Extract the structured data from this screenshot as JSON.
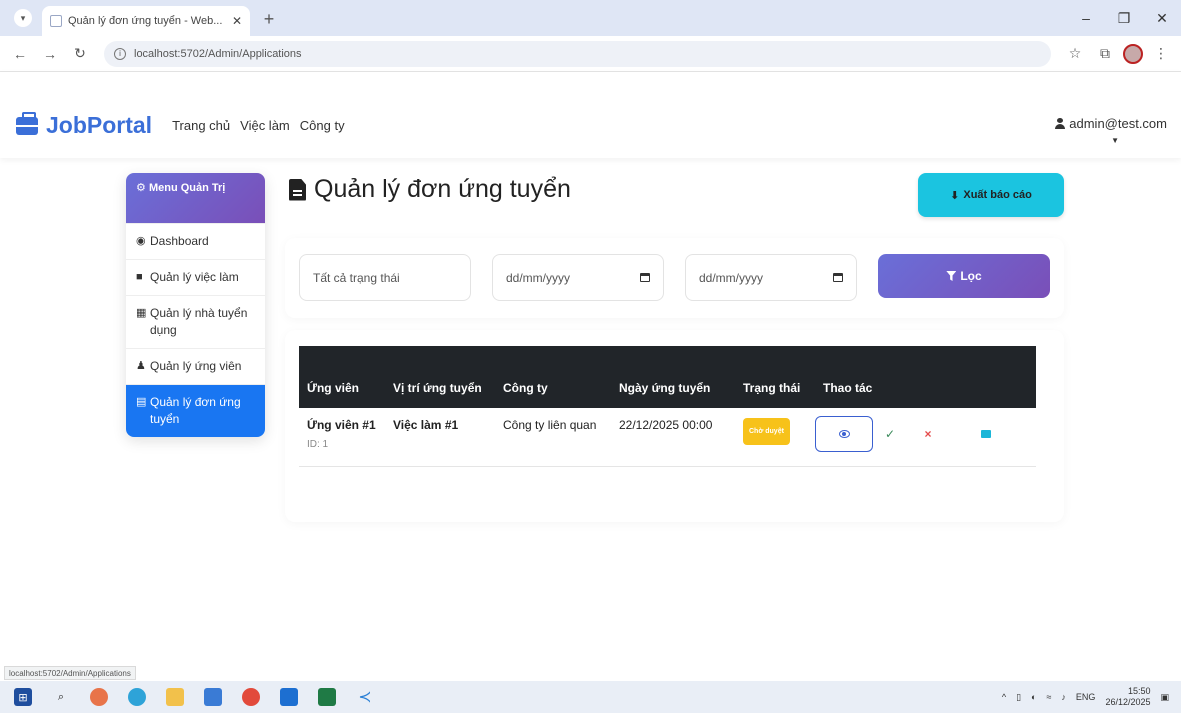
{
  "browser": {
    "tab_title": "Quản lý đơn ứng tuyển - Web...",
    "url": "localhost:5702/Admin/Applications",
    "status_url": "localhost:5702/Admin/Applications"
  },
  "navbar": {
    "brand": "JobPortal",
    "links": [
      "Trang chủ",
      "Việc làm",
      "Công ty"
    ],
    "user": "admin@test.com"
  },
  "sidebar": {
    "header": "Menu Quản Trị",
    "items": [
      {
        "label": "Dashboard",
        "icon": "gauge-icon",
        "glyph": "◉"
      },
      {
        "label": "Quản lý việc làm",
        "icon": "briefcase-icon",
        "glyph": "■"
      },
      {
        "label": "Quản lý nhà tuyển dụng",
        "icon": "building-icon",
        "glyph": "▦"
      },
      {
        "label": "Quản lý ứng viên",
        "icon": "users-icon",
        "glyph": "♟"
      },
      {
        "label": "Quản lý đơn ứng tuyển",
        "icon": "file-icon",
        "glyph": "▤",
        "active": true
      }
    ]
  },
  "page": {
    "title": "Quản lý đơn ứng tuyển",
    "export_label": "Xuất báo cáo"
  },
  "filters": {
    "status_value": "Tất cả trạng thái",
    "from_date": "dd/mm/yyyy",
    "to_date": "dd/mm/yyyy",
    "filter_label": "Lọc"
  },
  "table": {
    "headers": [
      "Ứng viên",
      "Vị trí ứng tuyển",
      "Công ty",
      "Ngày ứng tuyển",
      "Trạng thái",
      "Thao tác"
    ],
    "rows": [
      {
        "candidate": "Ứng viên #1",
        "candidate_id": "ID: 1",
        "job": "Việc làm #1",
        "company": "Công ty liên quan",
        "date": "22/12/2025 00:00",
        "status": "Chờ duyệt"
      }
    ]
  },
  "taskbar": {
    "lang": "ENG",
    "time": "15:50",
    "date": "26/12/2025"
  },
  "colors": {
    "brand": "#3b6fd8",
    "accent_gradient_start": "#6a6fd8",
    "accent_gradient_end": "#7a4fb8",
    "export_button": "#1bc4e0",
    "active_sidebar": "#1976f2",
    "status_pending": "#f7c21a"
  }
}
